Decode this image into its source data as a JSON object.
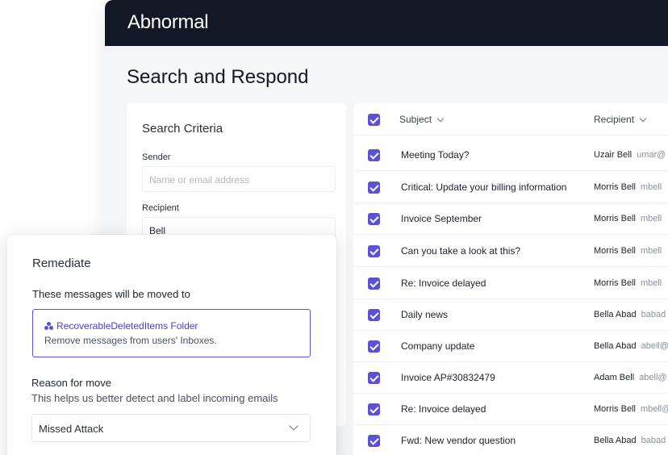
{
  "brand": {
    "logo_text": "Abnormal"
  },
  "page": {
    "title": "Search and Respond"
  },
  "criteria": {
    "title": "Search Criteria",
    "sender_label": "Sender",
    "sender_placeholder": "Name or email address",
    "recipient_label": "Recipient",
    "recipient_value": "Bell"
  },
  "table": {
    "columns": {
      "subject": "Subject",
      "recipient": "Recipient"
    },
    "rows": [
      {
        "subject": "Meeting Today?",
        "recipient_name": "Uzair Bell",
        "recipient_email": "umar@"
      },
      {
        "subject": "Critical: Update your billing information",
        "recipient_name": "Morris Bell",
        "recipient_email": "mbell"
      },
      {
        "subject": "Invoice September",
        "recipient_name": "Morris Bell",
        "recipient_email": "mbell"
      },
      {
        "subject": "Can you take a look at this?",
        "recipient_name": "Morris Bell",
        "recipient_email": "mbell"
      },
      {
        "subject": "Re: Invoice delayed",
        "recipient_name": "Morris Bell",
        "recipient_email": "mbell"
      },
      {
        "subject": "Daily news",
        "recipient_name": "Bella Abad",
        "recipient_email": "babad"
      },
      {
        "subject": "Company update",
        "recipient_name": "Bella Abad",
        "recipient_email": "abell@"
      },
      {
        "subject": "Invoice AP#30832479",
        "recipient_name": "Adam Bell",
        "recipient_email": "abell@"
      },
      {
        "subject": "Re: Invoice delayed",
        "recipient_name": "Morris Bell",
        "recipient_email": "mbell@"
      },
      {
        "subject": "Fwd: New vendor question",
        "recipient_name": "Bella Abad",
        "recipient_email": "babad"
      }
    ]
  },
  "remediate": {
    "title": "Remediate",
    "subtitle": "These messages will be moved to",
    "folder_name": "RecoverableDeletedItems Folder",
    "folder_desc": "Remove messages from users' Inboxes.",
    "reason_label": "Reason for move",
    "reason_help": "This helps us better detect and label incoming emails",
    "reason_value": "Missed Attack"
  },
  "colors": {
    "accent": "#5b50d6",
    "topbar": "#121826"
  }
}
